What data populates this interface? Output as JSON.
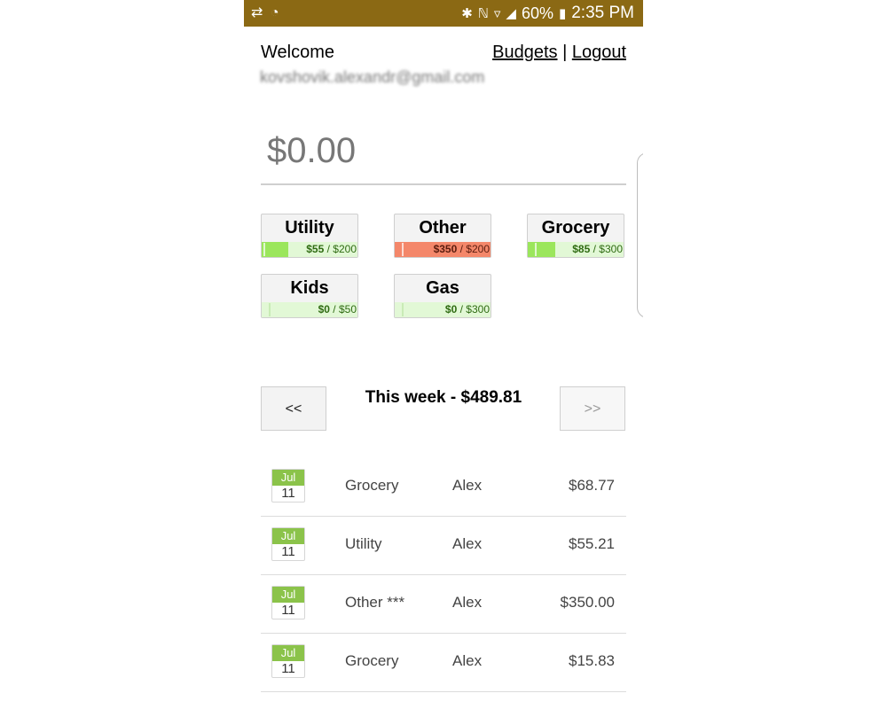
{
  "status_bar": {
    "battery": "60%",
    "time": "2:35 PM"
  },
  "header": {
    "welcome": "Welcome",
    "email": "kovshovik.alexandr@gmail.com",
    "budgets_link": "Budgets",
    "separator": "|",
    "logout_link": "Logout"
  },
  "amount_input": {
    "placeholder": "$0.00"
  },
  "categories": [
    {
      "name": "Utility",
      "spent": "$55",
      "limit": "$200",
      "fill_fraction": 0.275,
      "over": false
    },
    {
      "name": "Other",
      "spent": "$350",
      "limit": "$200",
      "fill_fraction": 1.0,
      "over": true
    },
    {
      "name": "Grocery",
      "spent": "$85",
      "limit": "$300",
      "fill_fraction": 0.283,
      "over": false
    },
    {
      "name": "Kids",
      "spent": "$0",
      "limit": "$50",
      "fill_fraction": 0.0,
      "over": false
    },
    {
      "name": "Gas",
      "spent": "$0",
      "limit": "$300",
      "fill_fraction": 0.0,
      "over": false
    }
  ],
  "week_nav": {
    "prev_label": "<<",
    "title": "This week - $489.81",
    "next_label": ">>"
  },
  "transactions": [
    {
      "month": "Jul",
      "day": "11",
      "category": "Grocery",
      "person": "Alex",
      "amount": "$68.77"
    },
    {
      "month": "Jul",
      "day": "11",
      "category": "Utility",
      "person": "Alex",
      "amount": "$55.21"
    },
    {
      "month": "Jul",
      "day": "11",
      "category": "Other ***",
      "person": "Alex",
      "amount": "$350.00"
    },
    {
      "month": "Jul",
      "day": "11",
      "category": "Grocery",
      "person": "Alex",
      "amount": "$15.83"
    }
  ],
  "colors": {
    "status_bar": "#8b6914",
    "under_budget_fill": "#9be65c",
    "under_budget_bg": "#e2f8d6",
    "over_budget": "#f4876a",
    "date_badge": "#8bc34a"
  }
}
